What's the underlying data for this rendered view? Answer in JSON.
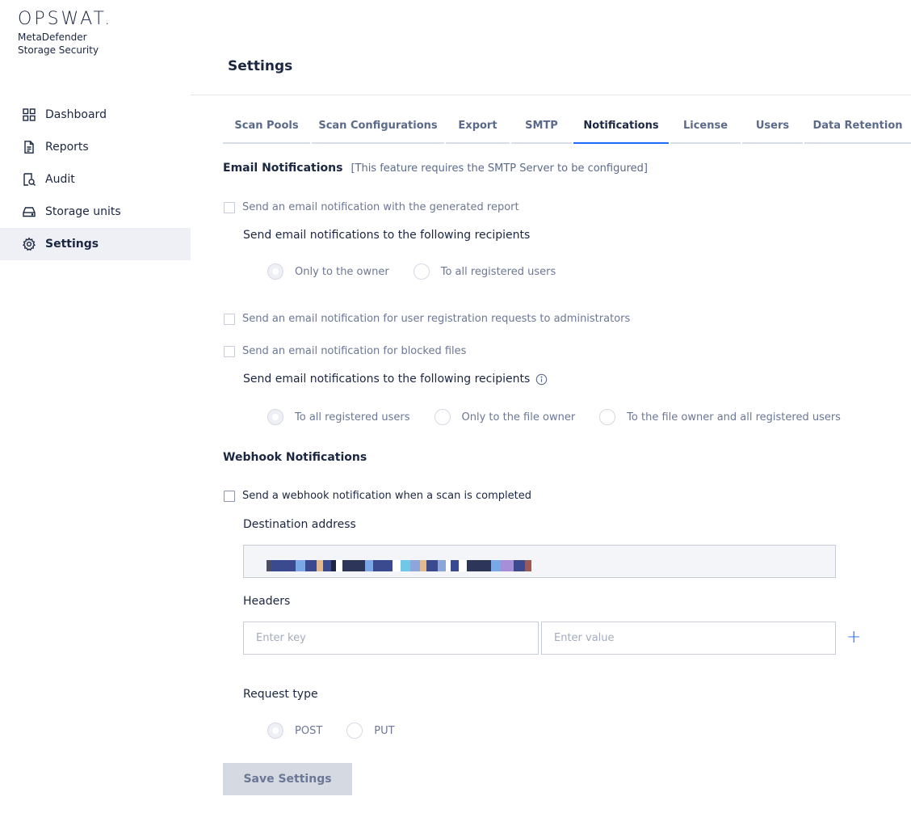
{
  "brand": {
    "logo": "OPSWAT.",
    "product_line1": "MetaDefender",
    "product_line2": "Storage Security"
  },
  "sidebar": {
    "items": [
      {
        "label": "Dashboard",
        "icon": "dashboard-grid-icon"
      },
      {
        "label": "Reports",
        "icon": "document-icon"
      },
      {
        "label": "Audit",
        "icon": "audit-icon"
      },
      {
        "label": "Storage units",
        "icon": "storage-drive-icon"
      },
      {
        "label": "Settings",
        "icon": "gear-icon",
        "active": true
      }
    ]
  },
  "header": {
    "title": "Settings"
  },
  "tabs": [
    {
      "label": "Scan Pools"
    },
    {
      "label": "Scan Configurations"
    },
    {
      "label": "Export"
    },
    {
      "label": "SMTP"
    },
    {
      "label": "Notifications",
      "active": true
    },
    {
      "label": "License"
    },
    {
      "label": "Users"
    },
    {
      "label": "Data Retention"
    }
  ],
  "email": {
    "title": "Email Notifications",
    "note": "[This feature requires the SMTP Server to be configured]",
    "report_checkbox": "Send an email notification with the generated report",
    "report_recipients_label": "Send email notifications to the following recipients",
    "report_options": [
      "Only to the owner",
      "To all registered users"
    ],
    "registration_checkbox": "Send an email notification for user registration requests to administrators",
    "blocked_checkbox": "Send an email notification for blocked files",
    "blocked_recipients_label": "Send email notifications to the following recipients",
    "blocked_options": [
      "To all registered users",
      "Only to the file owner",
      "To the file owner and all registered users"
    ]
  },
  "webhook": {
    "title": "Webhook Notifications",
    "checkbox": "Send a webhook notification when a scan is completed",
    "destination_label": "Destination address",
    "headers_label": "Headers",
    "key_placeholder": "Enter key",
    "value_placeholder": "Enter value",
    "add_symbol": "+",
    "request_type_label": "Request type",
    "request_options": [
      "POST",
      "PUT"
    ]
  },
  "actions": {
    "save_label": "Save Settings"
  },
  "colors": {
    "accent": "#1d6bfc",
    "text_dark": "#1b2640",
    "text_muted": "#6b7794",
    "disabled_button": "#d5d9e2"
  }
}
